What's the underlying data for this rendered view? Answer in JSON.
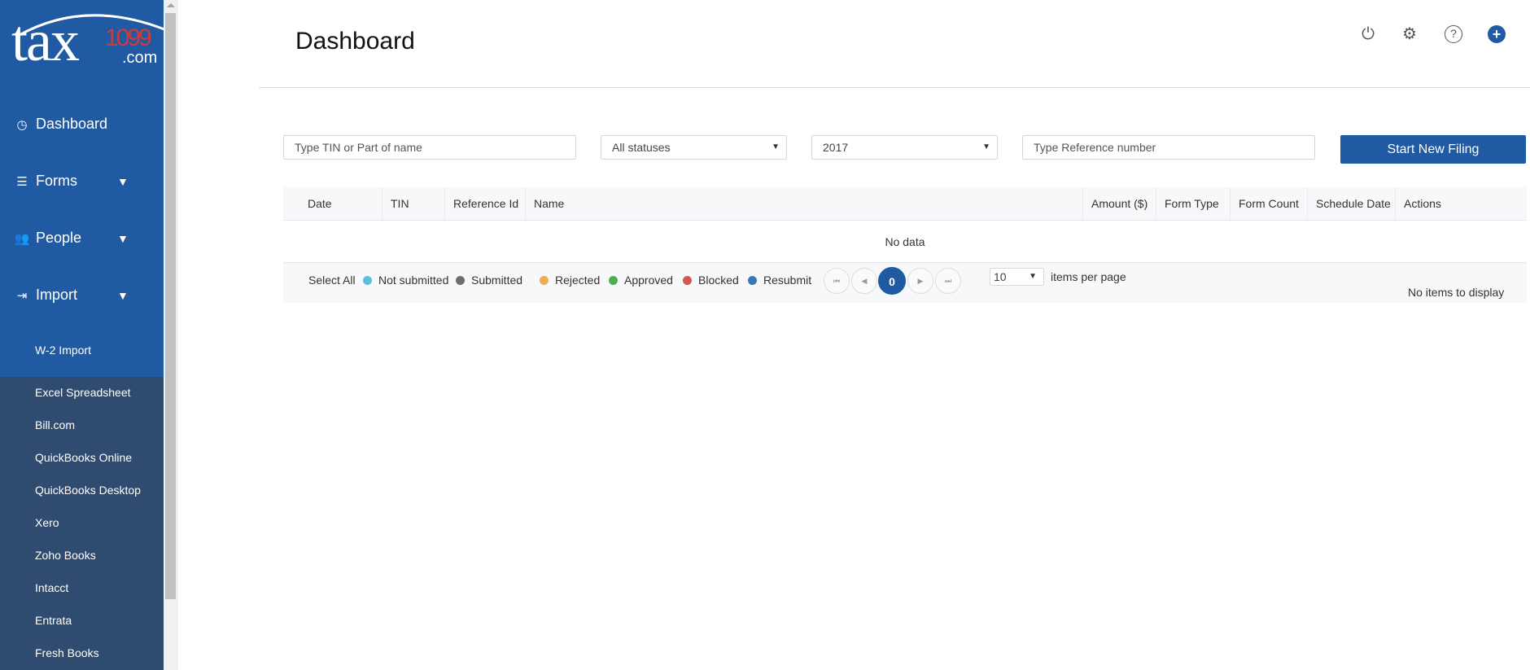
{
  "logo": {
    "text": "tax1099.com",
    "tax": "tax",
    "num": "1099",
    "com": ".com"
  },
  "sidebar": {
    "items": [
      {
        "label": "Dashboard",
        "icon": "dashboard-gauge-icon"
      },
      {
        "label": "Forms",
        "icon": "forms-list-icon"
      },
      {
        "label": "People",
        "icon": "people-icon"
      },
      {
        "label": "Import",
        "icon": "import-icon"
      }
    ],
    "import_items": [
      "W-2 Import",
      "Excel Spreadsheet",
      "Bill.com",
      "QuickBooks Online",
      "QuickBooks Desktop",
      "Xero",
      "Zoho Books",
      "Intacct",
      "Entrata",
      "Fresh Books"
    ]
  },
  "header": {
    "title": "Dashboard",
    "icons": [
      "power-icon",
      "gear-icon",
      "help-icon",
      "add-icon"
    ]
  },
  "filters": {
    "tin_placeholder": "Type TIN or Part of name",
    "status": "All statuses",
    "year": "2017",
    "ref_placeholder": "Type Reference number",
    "start_button": "Start New Filing"
  },
  "table": {
    "columns": [
      "Date",
      "TIN",
      "Reference Id",
      "Name",
      "Amount ($)",
      "Form Type",
      "Form Count",
      "Schedule Date",
      "Actions"
    ],
    "empty": "No data"
  },
  "footer": {
    "select_all": "Select All",
    "legend": [
      {
        "label": "Not submitted",
        "color": "#5bc0de"
      },
      {
        "label": "Submitted",
        "color": "#6d6d6d"
      },
      {
        "label": "Rejected",
        "color": "#f0ad4e"
      },
      {
        "label": "Approved",
        "color": "#4cae4c"
      },
      {
        "label": "Blocked",
        "color": "#d9534f"
      },
      {
        "label": "Resubmit",
        "color": "#337ab7"
      }
    ],
    "page": "0",
    "per_page": "10",
    "per_page_label": "items per page",
    "status": "No items to display"
  },
  "colors": {
    "brand": "#1f5aa2",
    "sidebar_dark": "#2f4c70",
    "logo_red": "#d13a3a"
  }
}
